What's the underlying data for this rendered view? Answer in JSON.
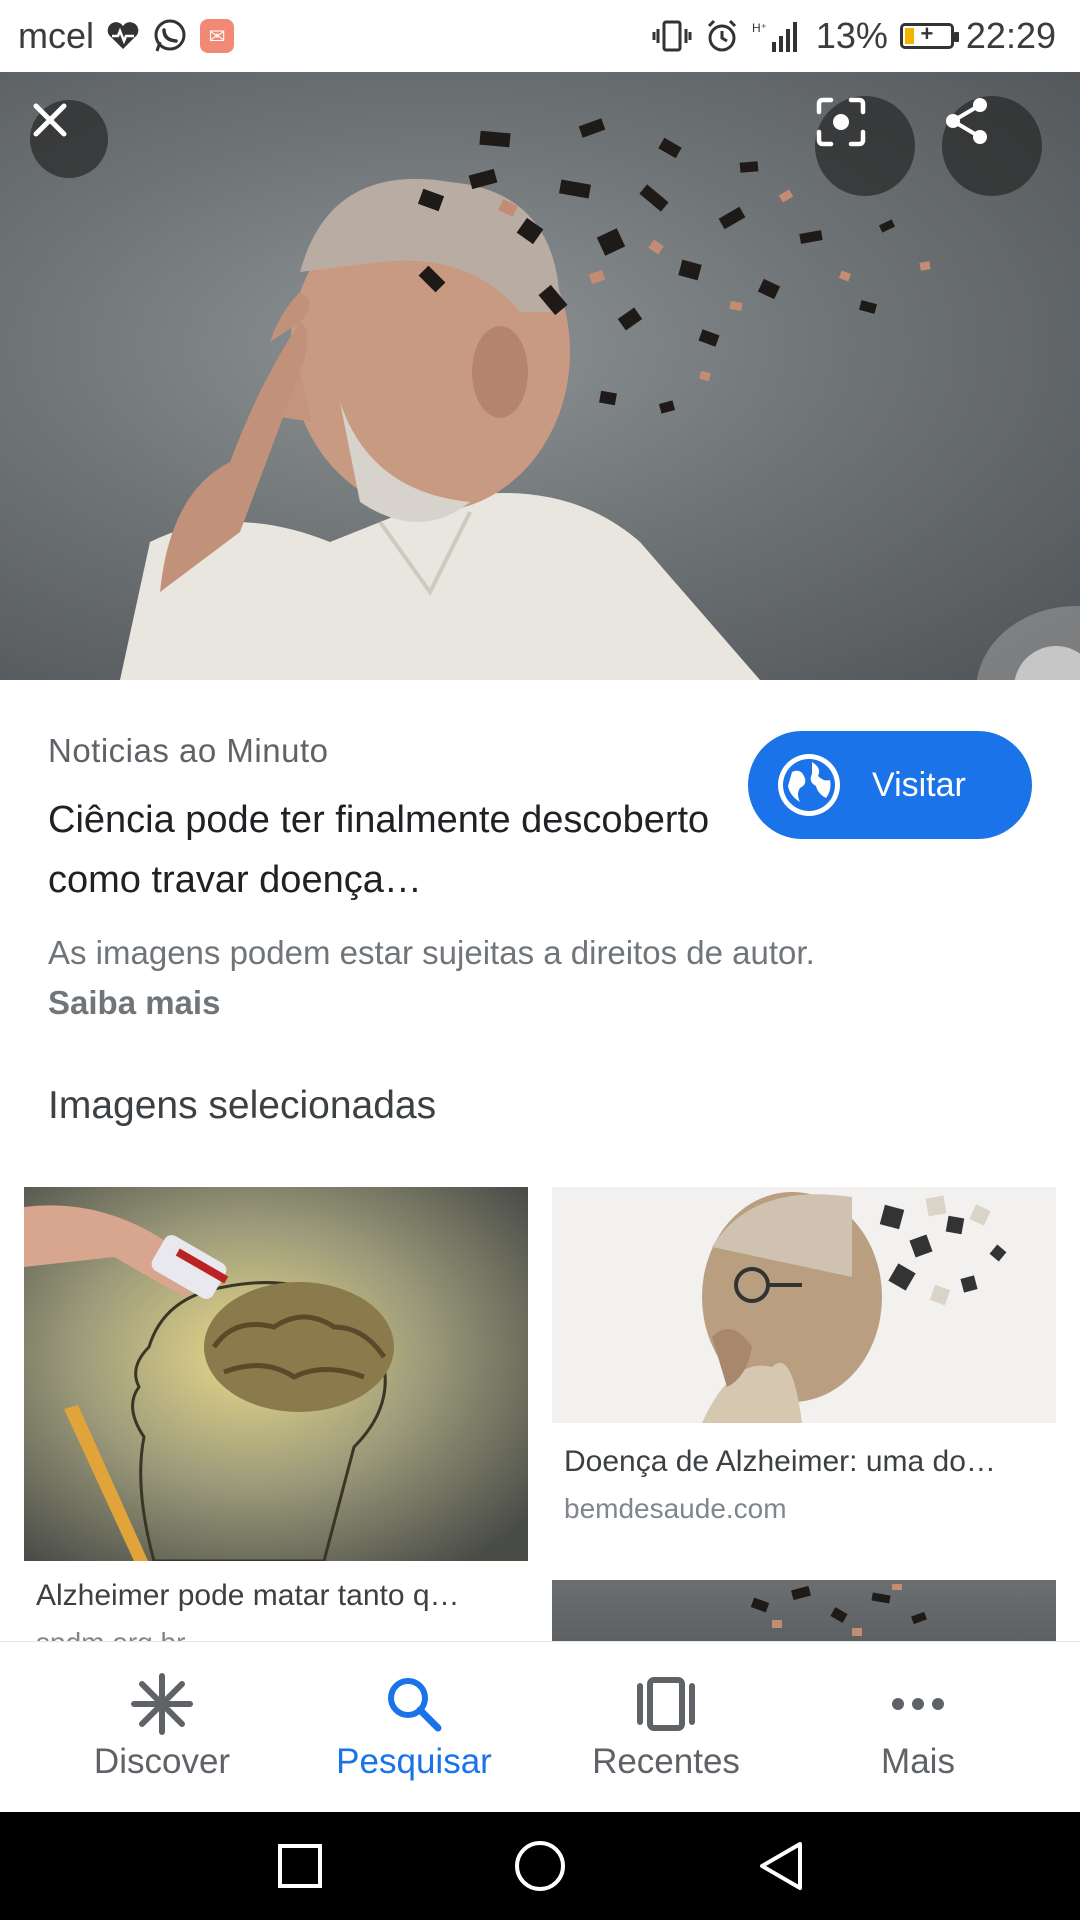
{
  "status_bar": {
    "carrier": "mcel",
    "battery": "13%",
    "time": "22:29"
  },
  "result": {
    "source": "Noticias ao Minuto",
    "title": "Ciência pode ter finalmente descoberto como travar doença…",
    "visit_label": "Visitar",
    "rights_text": "As imagens podem estar sujeitas a direitos de autor.",
    "learn_more": "Saiba mais"
  },
  "related": {
    "heading": "Imagens selecionadas",
    "items": [
      {
        "caption": "Alzheimer pode matar tanto q…",
        "domain": "spdm.org.br"
      },
      {
        "caption": "Doença de Alzheimer: uma do…",
        "domain": "bemdesaude.com"
      }
    ]
  },
  "bottom_nav": {
    "items": [
      {
        "label": "Discover",
        "icon": "asterisk-icon"
      },
      {
        "label": "Pesquisar",
        "icon": "search-icon",
        "active": true
      },
      {
        "label": "Recentes",
        "icon": "recent-cards-icon"
      },
      {
        "label": "Mais",
        "icon": "more-horiz-icon"
      }
    ]
  },
  "colors": {
    "accent": "#1a73e8",
    "system_nav_bg": "#000000"
  }
}
